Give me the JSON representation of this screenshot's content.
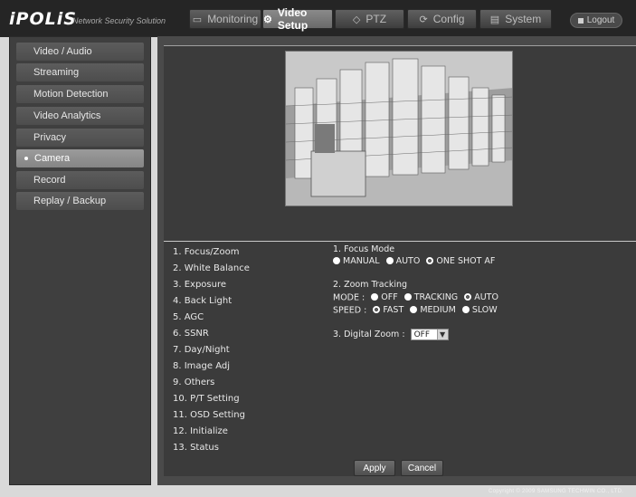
{
  "header": {
    "logo": "iPOLiS",
    "tagline": "Network Security Solution",
    "tabs": [
      {
        "label": "Monitoring",
        "icon": "monitor-icon"
      },
      {
        "label": "Video Setup",
        "icon": "video-setup-icon"
      },
      {
        "label": "PTZ",
        "icon": "ptz-icon"
      },
      {
        "label": "Config",
        "icon": "config-icon"
      },
      {
        "label": "System",
        "icon": "system-icon"
      }
    ],
    "active_tab": "Video Setup",
    "logout": "Logout"
  },
  "sidebar": {
    "items": [
      {
        "label": "Video / Audio"
      },
      {
        "label": "Streaming"
      },
      {
        "label": "Motion Detection"
      },
      {
        "label": "Video Analytics"
      },
      {
        "label": "Privacy"
      },
      {
        "label": "Camera"
      },
      {
        "label": "Record"
      },
      {
        "label": "Replay / Backup"
      }
    ],
    "active": "Camera"
  },
  "camera_menu": {
    "items": [
      "1. Focus/Zoom",
      "2. White Balance",
      "3. Exposure",
      "4. Back Light",
      "5. AGC",
      "6. SSNR",
      "7. Day/Night",
      "8. Image Adj",
      "9. Others",
      "10. P/T Setting",
      "11. OSD Setting",
      "12. Initialize",
      "13. Status"
    ]
  },
  "settings": {
    "focus_mode": {
      "title": "1. Focus Mode",
      "options": [
        "MANUAL",
        "AUTO",
        "ONE SHOT AF"
      ],
      "selected": "ONE SHOT AF"
    },
    "zoom_tracking": {
      "title": "2. Zoom Tracking",
      "mode_label": "MODE :",
      "mode_options": [
        "OFF",
        "TRACKING",
        "AUTO"
      ],
      "mode_selected": "AUTO",
      "speed_label": "SPEED :",
      "speed_options": [
        "FAST",
        "MEDIUM",
        "SLOW"
      ],
      "speed_selected": "FAST"
    },
    "digital_zoom": {
      "label": "3. Digital Zoom :",
      "value": "OFF"
    }
  },
  "buttons": {
    "apply": "Apply",
    "cancel": "Cancel"
  },
  "footer": {
    "copyright": "Copyright © 2009 SAMSUNG TECHWIN CO., LTD."
  },
  "colors": {
    "header_bg": "#252525",
    "panel_bg": "#3b3b3b",
    "active_sidebar": "#9b9b9b"
  }
}
